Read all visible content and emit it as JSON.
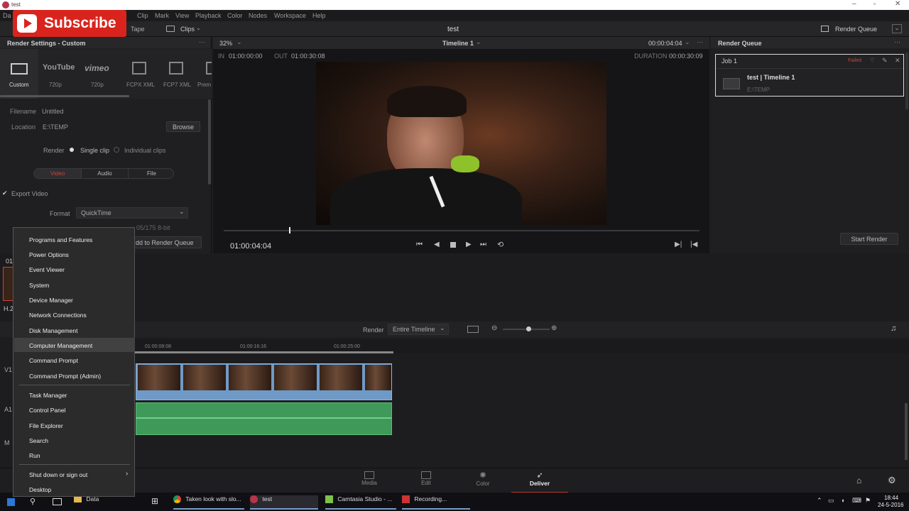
{
  "window": {
    "title": "test"
  },
  "overlay": {
    "subscribe_label": "Subscribe"
  },
  "menu": {
    "items": [
      "Clip",
      "Mark",
      "View",
      "Playback",
      "Color",
      "Nodes",
      "Workspace",
      "Help"
    ],
    "first": "Da"
  },
  "toolbar": {
    "tape": "Tape",
    "clips": "Clips",
    "project_title": "test",
    "render_queue": "Render Queue"
  },
  "render_settings": {
    "header": "Render Settings - Custom",
    "presets": [
      "Custom",
      "720p",
      "720p",
      "FCPX XML",
      "FCP7 XML",
      "Prem"
    ],
    "preset_logos": [
      "YouTube",
      "vimeo"
    ],
    "filename_label": "Filename",
    "filename_value": "Untitled",
    "location_label": "Location",
    "location_value": "E:\\TEMP",
    "browse": "Browse",
    "render_label": "Render",
    "single_clip": "Single clip",
    "individual_clips": "Individual clips",
    "tabs": [
      "Video",
      "Audio",
      "File"
    ],
    "export_video": "Export Video",
    "format_label": "Format",
    "format_value": "QuickTime",
    "codec_partial": "05/175 8-bit",
    "add_to_queue": "dd to Render Queue"
  },
  "viewer": {
    "zoom": "32%",
    "timeline_name": "Timeline 1",
    "timecode_top": "00:00:04:04",
    "in_label": "IN",
    "in_value": "01:00:00:00",
    "out_label": "OUT",
    "out_value": "01:00:30:08",
    "duration_label": "DURATION",
    "duration_value": "00:00:30:09",
    "current_tc": "01:00:04:04"
  },
  "render_queue": {
    "header": "Render Queue",
    "job": {
      "name": "Job 1",
      "status": "Failed",
      "title": "test | Timeline 1",
      "path": "E:\\TEMP"
    },
    "start_render": "Start Render"
  },
  "clip_strip": {
    "tc_partial": "01",
    "label_partial": "H.2"
  },
  "timeline": {
    "render_label": "Render",
    "render_value": "Entire Timeline",
    "ruler": [
      "01:00:08:08",
      "01:00:16:16",
      "01:00:25:00"
    ],
    "tracks": [
      "V1",
      "A1",
      "M"
    ]
  },
  "pages": [
    {
      "label": "Media",
      "active": false
    },
    {
      "label": "Edit",
      "active": false
    },
    {
      "label": "Color",
      "active": false
    },
    {
      "label": "Deliver",
      "active": true
    }
  ],
  "context_menu": {
    "groups": [
      [
        "Programs and Features",
        "Power Options",
        "Event Viewer",
        "System",
        "Device Manager",
        "Network Connections",
        "Disk Management",
        "Computer Management",
        "Command Prompt",
        "Command Prompt (Admin)"
      ],
      [
        "Task Manager",
        "Control Panel",
        "File Explorer",
        "Search",
        "Run"
      ],
      [
        "Shut down or sign out",
        "Desktop"
      ]
    ],
    "highlighted": "Computer Management"
  },
  "taskbar": {
    "items": [
      "Data",
      "Taken look with slo...",
      "test",
      "Camtasia Studio - ...",
      "Recording..."
    ],
    "time": "18:44",
    "date": "24-5-2016"
  },
  "colors": {
    "accent_red": "#d9241d",
    "deliver_underline": "#c0392b",
    "video_track": "#6f9ac7",
    "audio_track": "#3f9a5a",
    "failed": "#d0413a"
  }
}
